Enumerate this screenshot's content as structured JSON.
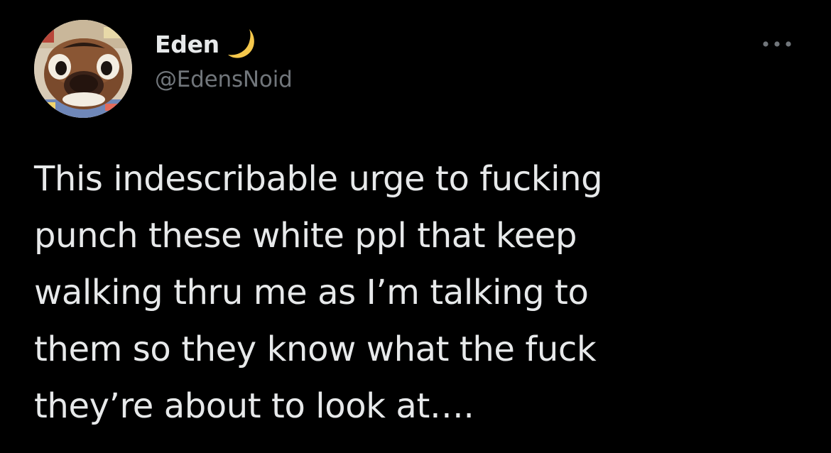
{
  "author": {
    "display_name": "Eden",
    "display_name_emoji": "crescent-moon-icon",
    "handle": "@EdensNoid",
    "avatar": "animal-crossing-tanuki-avatar"
  },
  "menu": {
    "icon": "more-horizontal-icon"
  },
  "tweet": {
    "lines": [
      "This indescribable urge to fucking",
      "punch these white ppl that keep",
      "walking thru me as I’m talking to",
      "them so they know what the fuck",
      "they’re about to look at…."
    ]
  },
  "colors": {
    "background": "#000000",
    "primary_text": "#e7e9ea",
    "secondary_text": "#71767b",
    "moon": "#f5c84c"
  }
}
